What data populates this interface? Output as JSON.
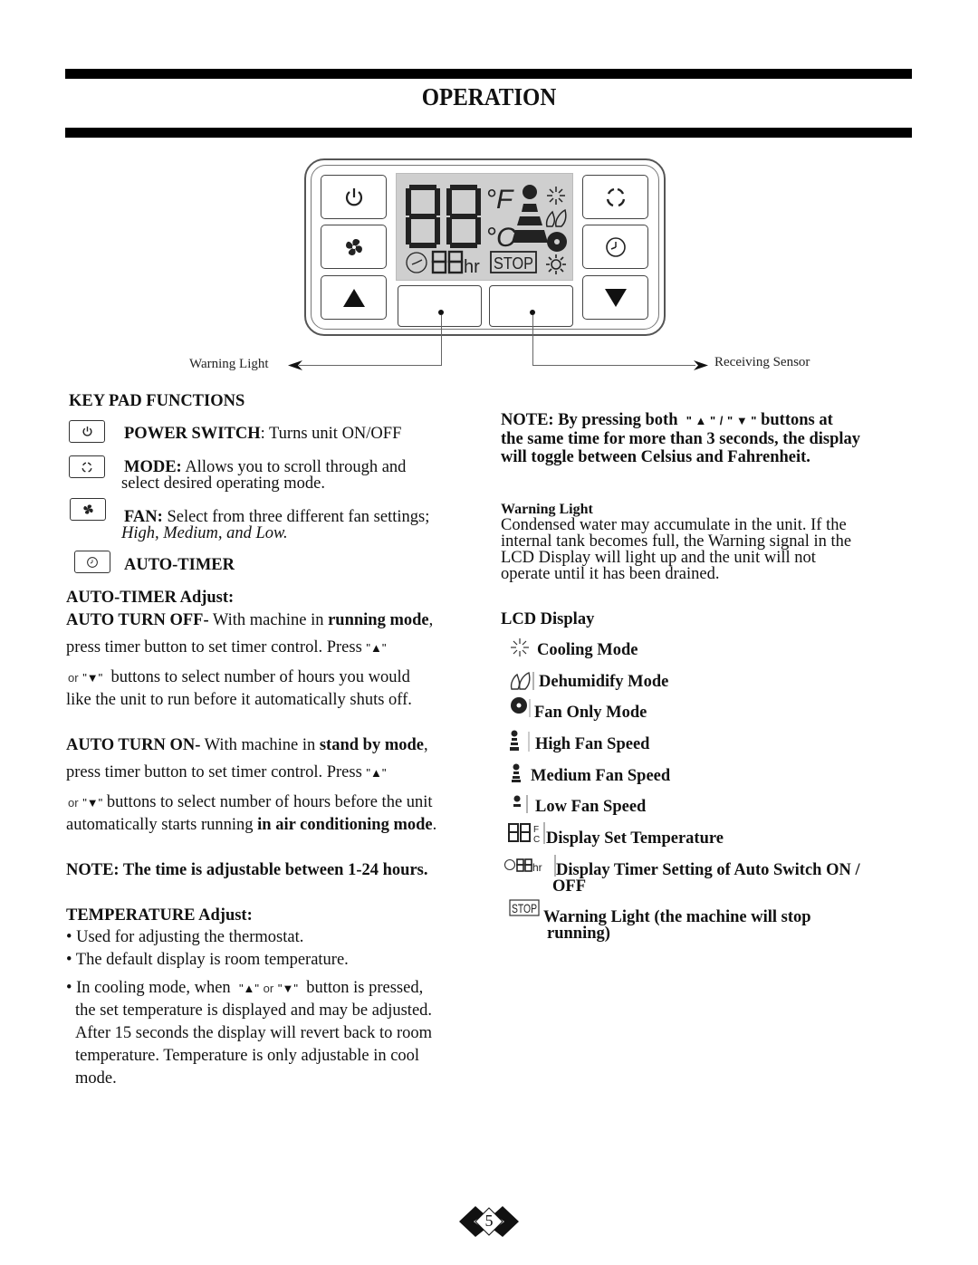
{
  "page": {
    "title": "OPERATION",
    "page_number": "5"
  },
  "control_panel": {
    "keys": {
      "power": "power-icon",
      "fan": "fan-icon",
      "up": "up-arrow-icon",
      "mode": "mode-cycle-icon",
      "timer": "clock-icon",
      "down": "down-arrow-icon"
    },
    "lcd": {
      "temp_digits": "88",
      "unit_f": "°F",
      "unit_c": "°C",
      "timer_digits": "88",
      "timer_unit": "hr",
      "stop_label": "STOP"
    },
    "callouts": {
      "warning_light": "Warning Light",
      "receiving_sensor": "Receiving Sensor"
    }
  },
  "keypad": {
    "heading": "KEY PAD FUNCTIONS",
    "power": {
      "label": "POWER SWITCH",
      "text": ": Turns unit ON/OFF"
    },
    "mode": {
      "label": "MODE:",
      "text": " Allows you to scroll through and",
      "text2": "select desired operating mode."
    },
    "fan": {
      "label": "FAN:",
      "text": " Select from three different fan settings;",
      "text2": "High, Medium, and Low."
    },
    "timer": {
      "label": "AUTO-TIMER"
    }
  },
  "auto_timer": {
    "heading": "AUTO-TIMER Adjust:",
    "off": {
      "label": "AUTO TURN OFF-",
      "text_a": " With machine in ",
      "bold_a": "running mode",
      "text_b": ",",
      "line2": "press timer button to set timer control. Press",
      "up_q": "\"▲\"",
      "or": "or",
      "down_q": "\"▼\"",
      "line3": "buttons to select number of hours you would",
      "line4": "like the unit to run before it automatically shuts off."
    },
    "on": {
      "label": "AUTO TURN ON-",
      "text_a": " With machine in ",
      "bold_a": "stand by mode",
      "text_b": ",",
      "line2": "press timer button to set timer control. Press",
      "up_q": "\"▲\"",
      "or": "or",
      "down_q": "\"▼\"",
      "line3": "buttons to select number of hours before the unit",
      "line4a": "automatically starts running ",
      "line4b": "in air conditioning mode",
      "line4c": "."
    },
    "note": "NOTE: The time is adjustable between 1-24 hours."
  },
  "temperature": {
    "heading": "TEMPERATURE Adjust:",
    "bullets": [
      "• Used for adjusting the thermostat.",
      "• The default display is room temperature."
    ],
    "b3_a": "• In cooling mode, when",
    "up_q": "\"▲\"",
    "or": "or",
    "down_q": "\"▼\"",
    "b3_b": "button is pressed,",
    "b3_lines": [
      "the set temperature is displayed and may be adjusted.",
      "After 15 seconds the display will revert back to room",
      "temperature. Temperature is only adjustable in cool",
      "mode."
    ]
  },
  "right": {
    "note_a": "NOTE: By pressing both",
    "note_up": "\" ▲ \"",
    "note_slash": "/",
    "note_down": "\" ▼ \"",
    "note_b": "buttons at",
    "note_lines": [
      "the same time for more than 3 seconds, the display",
      "will toggle between Celsius and Fahrenheit."
    ],
    "warning_heading": "Warning Light",
    "warning_lines": [
      "Condensed water may accumulate in the unit. If the",
      "internal tank becomes full, the Warning signal in the",
      "LCD Display will light up and the unit will not",
      "operate until it has been drained."
    ],
    "lcd_heading": "LCD Display",
    "lcd_items": [
      {
        "icon": "snowflake-icon",
        "label": "Cooling Mode"
      },
      {
        "icon": "droplets-icon",
        "label": "Dehumidify Mode"
      },
      {
        "icon": "fan-only-icon",
        "label": "Fan Only Mode"
      },
      {
        "icon": "high-fan-icon",
        "label": "High Fan Speed"
      },
      {
        "icon": "medium-fan-icon",
        "label": "Medium Fan Speed"
      },
      {
        "icon": "low-fan-icon",
        "label": "Low Fan Speed"
      },
      {
        "icon": "set-temp-icon",
        "label": "Display Set Temperature"
      },
      {
        "icon": "timer-display-icon",
        "label": "Display Timer Setting of Auto Switch ON /",
        "label2": "OFF"
      },
      {
        "icon": "stop-icon",
        "label": "Warning Light (the machine will stop",
        "label2": "running)"
      }
    ]
  }
}
